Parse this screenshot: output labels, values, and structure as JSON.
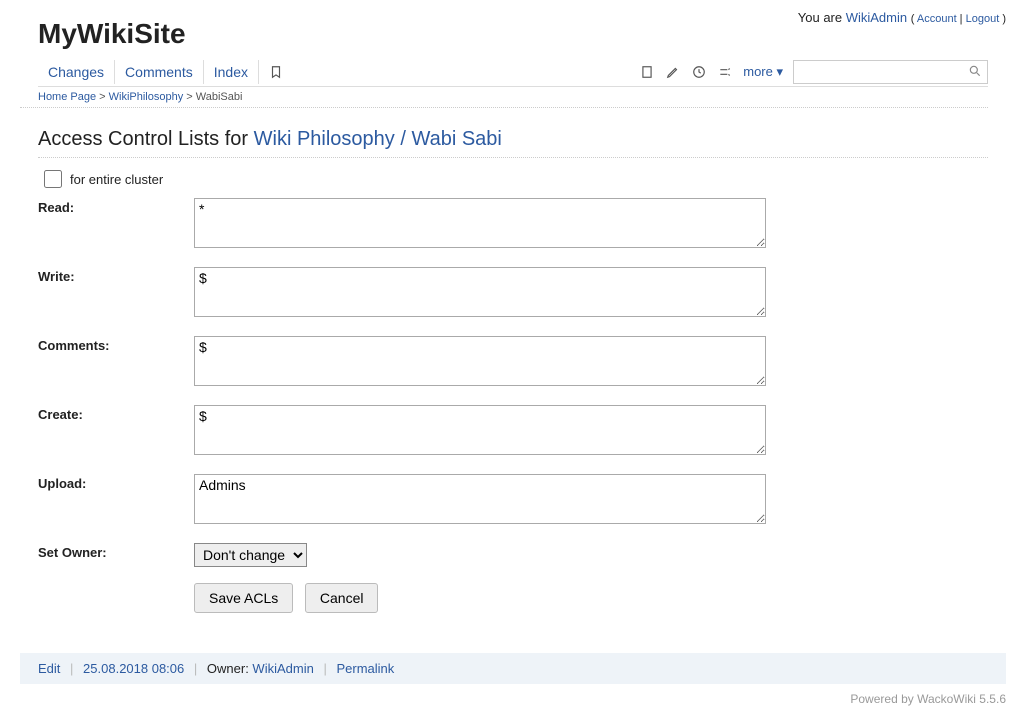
{
  "header": {
    "site_title": "MyWikiSite",
    "you_are": "You are ",
    "username": "WikiAdmin",
    "account": "Account",
    "logout": "Logout"
  },
  "nav": {
    "changes": "Changes",
    "comments": "Comments",
    "index": "Index",
    "more": "more ▾",
    "search_placeholder": ""
  },
  "breadcrumb": {
    "home": "Home Page",
    "parent": "WikiPhilosophy",
    "current": "WabiSabi"
  },
  "page": {
    "title_prefix": "Access Control Lists for ",
    "title_link": "Wiki Philosophy / Wabi Sabi"
  },
  "form": {
    "cluster_label": "for entire cluster",
    "read_label": "Read:",
    "read_value": "*",
    "write_label": "Write:",
    "write_value": "$",
    "comments_label": "Comments:",
    "comments_value": "$",
    "create_label": "Create:",
    "create_value": "$",
    "upload_label": "Upload:",
    "upload_value": "Admins",
    "owner_label": "Set Owner:",
    "owner_value": "Don't change",
    "save_btn": "Save ACLs",
    "cancel_btn": "Cancel"
  },
  "footer": {
    "edit": "Edit",
    "date": "25.08.2018 08:06",
    "owner_prefix": "Owner: ",
    "owner": "WikiAdmin",
    "permalink": "Permalink",
    "powered": "Powered by WackoWiki 5.5.6"
  }
}
